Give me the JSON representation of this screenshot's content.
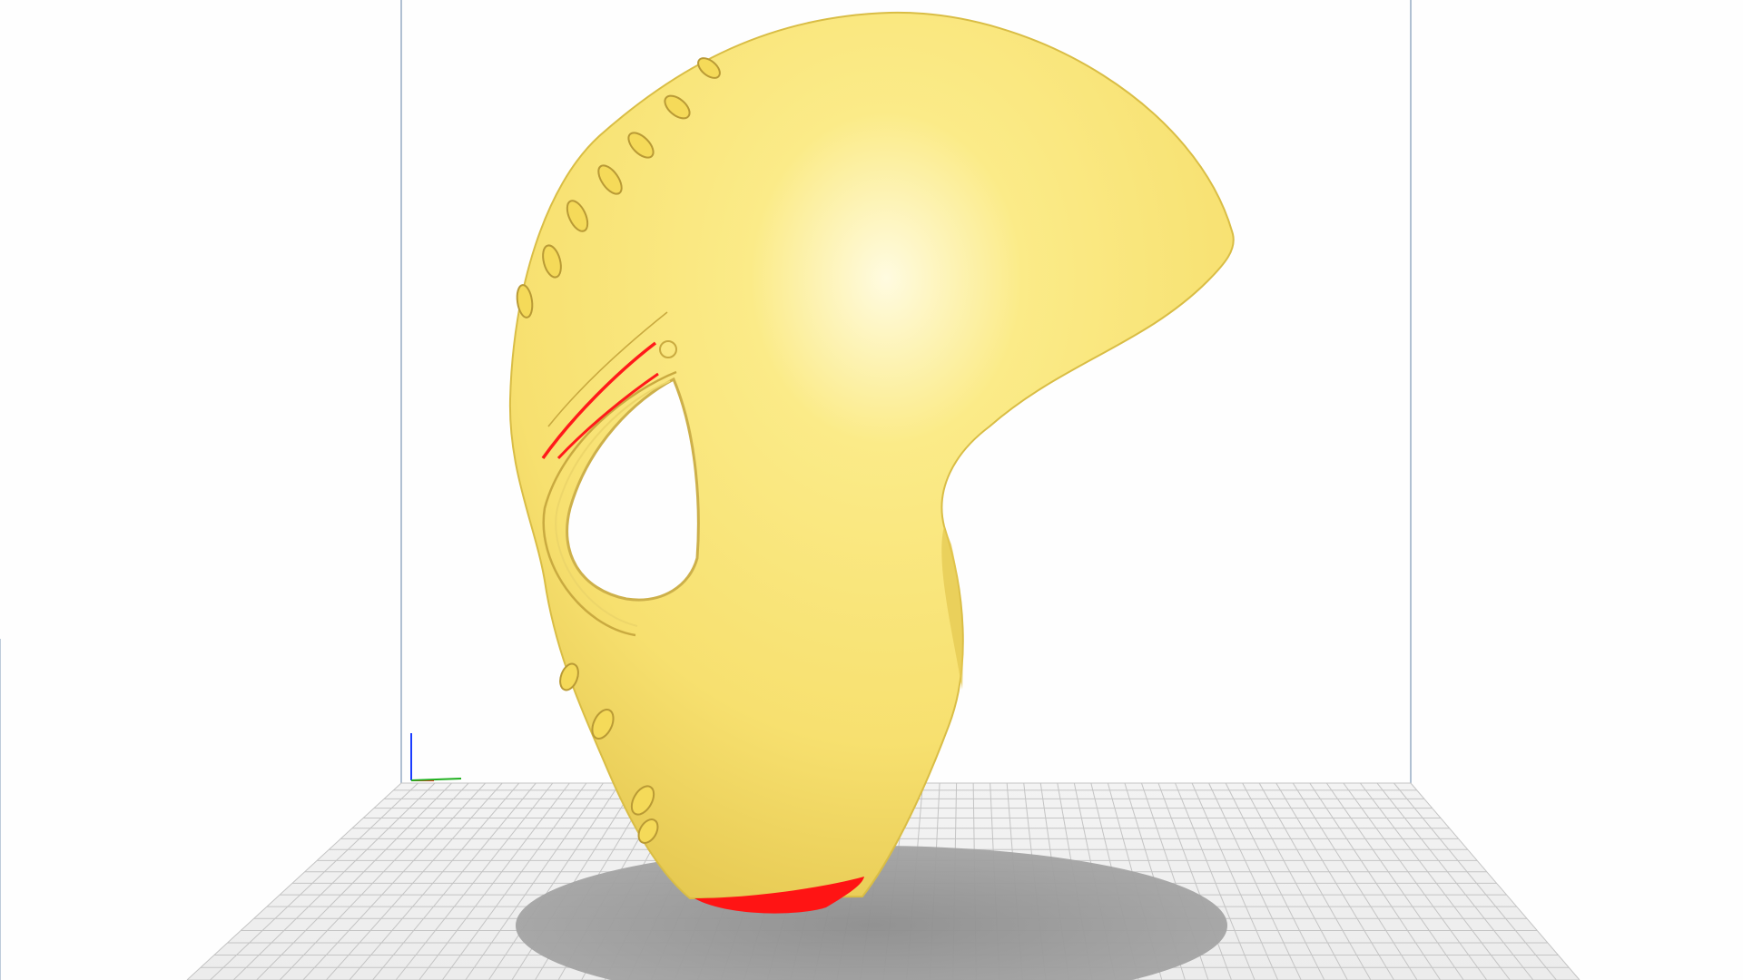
{
  "app": {
    "kind": "3d-print-slicer-viewport",
    "model": {
      "description_icon": "helmet-model",
      "fill_color": "#f7e06f",
      "highlight_color": "#fffbe0",
      "shadow_color": "#d9bd45",
      "overhang_color": "#ff0000"
    },
    "build_plate": {
      "grid_color": "#c9c9c9",
      "plate_color": "#f1f1f1",
      "volume_edge_color": "#6c8fb0"
    },
    "axes": {
      "x_color": "#ff0000",
      "y_color": "#00b000",
      "z_color": "#0000ff"
    },
    "shadow_color": "#8f8f8f"
  }
}
